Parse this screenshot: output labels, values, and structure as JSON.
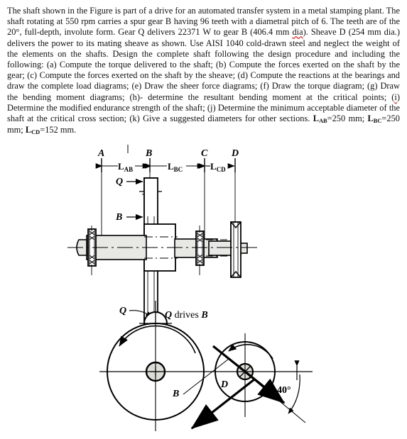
{
  "problem": {
    "paragraph_1": "The shaft shown in the Figure is part of a drive for an automated transfer system in a metal stamping plant. The shaft rotating at 550 rpm carries a spur gear B having 96 teeth with a diametral pitch of 6. The teeth are of the 20°, full-depth, involute form. Gear Q delivers 22371 W to gear B (406.4 mm ",
    "misspelled_word_1": "dia",
    "paragraph_2": "). Sheave D (254 mm dia.) delivers the power to its mating sheave as shown. Use AISI 1040 cold-drawn steel and neglect the weight of the elements on the shafts. Design the complete shaft following the design procedure and including the following: (a) Compute the torque delivered to the shaft; (b) Compute the forces exerted on the shaft by the gear; (c) Compute the forces exerted on the shaft by the sheave; (d) Compute the reactions at the bearings and draw the complete load diagrams; (e) Draw the sheer force diagrams; (f) Draw the torque diagram; (g) Draw the bending moment diagrams; (h)- determine the resultant bending moment at the critical points; (",
    "misspelled_word_2": "i",
    "paragraph_3": ") Determine the modified endurance strength of the shaft; (j) Determine the minimum acceptable diameter of the shaft at the critical cross section; (k) Give a suggested diameters for other sections.  ",
    "dim_ab_label": "L",
    "dim_ab_sub": "AB",
    "dim_ab_value": "=250 mm; ",
    "dim_bc_label": "L",
    "dim_bc_sub": "BC",
    "dim_bc_value": "=250 mm; ",
    "dim_cd_label": "L",
    "dim_cd_sub": "CD",
    "dim_cd_value": "=152 mm.",
    "rotation_speed": "550 rpm",
    "gear_teeth": "96 teeth",
    "diametral_pitch": "6",
    "pressure_angle": "20°",
    "power_watts": "22371 W",
    "gear_b_diameter": "406.4 mm",
    "sheave_d_diameter": "254 mm",
    "material": "AISI 1040 cold-drawn steel"
  },
  "figure": {
    "station_labels": {
      "a": "A",
      "b": "B",
      "c": "C",
      "d": "D"
    },
    "dimension_labels": {
      "ab": "L",
      "ab_sub": "AB",
      "bc": "L",
      "bc_sub": "BC",
      "cd": "L",
      "cd_sub": "CD"
    },
    "callouts": {
      "q_gear": "Q",
      "b_gear": "B",
      "q_lower": "Q",
      "q_drives_b": "Q drives B",
      "circle_b": "B",
      "circle_d": "D",
      "belt_angle": "40°"
    },
    "colors": {
      "line": "#000000",
      "shaft_fill": "#e8e8e4",
      "hub_fill": "#dcdcd8",
      "paper": "#ffffff"
    }
  }
}
